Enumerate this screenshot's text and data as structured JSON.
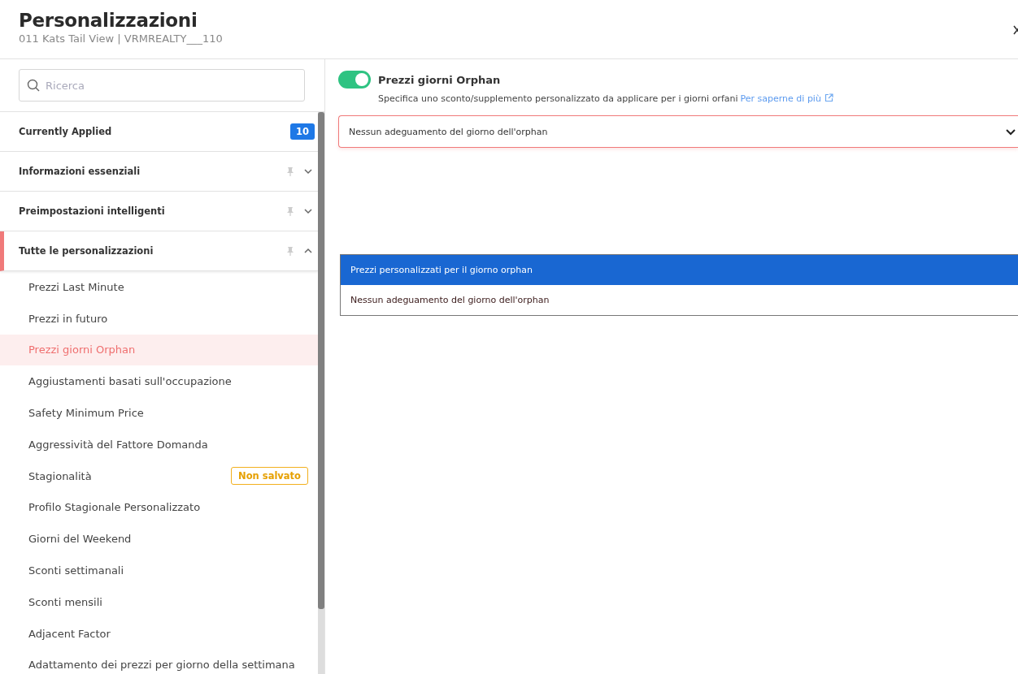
{
  "header": {
    "title": "Personalizzazioni",
    "subtitle": "011 Kats Tail View | VRMREALTY___110"
  },
  "search": {
    "placeholder": "Ricerca"
  },
  "sections": [
    {
      "label": "Currently Applied",
      "kind": "count",
      "count": "10"
    },
    {
      "label": "Informazioni essenziali",
      "kind": "group",
      "expanded": false,
      "selected": false
    },
    {
      "label": "Preimpostazioni intelligenti",
      "kind": "group",
      "expanded": false,
      "selected": false
    },
    {
      "label": "Tutte le personalizzazioni",
      "kind": "group",
      "expanded": true,
      "selected": true,
      "children": [
        {
          "label": "Prezzi Last Minute",
          "selected": false
        },
        {
          "label": "Prezzi in futuro",
          "selected": false
        },
        {
          "label": "Prezzi giorni Orphan",
          "selected": true
        },
        {
          "label": "Aggiustamenti basati sull'occupazione",
          "selected": false
        },
        {
          "label": "Safety Minimum Price",
          "selected": false
        },
        {
          "label": "Aggressività del Fattore Domanda",
          "selected": false
        },
        {
          "label": "Stagionalità",
          "selected": false,
          "badge": "Non salvato"
        },
        {
          "label": "Profilo Stagionale Personalizzato",
          "selected": false
        },
        {
          "label": "Giorni del Weekend",
          "selected": false
        },
        {
          "label": "Sconti settimanali",
          "selected": false
        },
        {
          "label": "Sconti mensili",
          "selected": false
        },
        {
          "label": "Adjacent Factor",
          "selected": false
        },
        {
          "label": "Adattamento dei prezzi per giorno della settimana",
          "selected": false
        }
      ]
    }
  ],
  "setting": {
    "title": "Prezzi giorni Orphan",
    "on": true,
    "description": "Specifica uno sconto/supplemento personalizzato da applicare per i giorni orfani",
    "link": "Per saperne di più"
  },
  "dropdown": {
    "value": "Nessun adeguamento del giorno dell'orphan",
    "invalid": true,
    "options": [
      {
        "label": "Prezzi personalizzati per il giorno orphan",
        "selected": false,
        "highlighted": true
      },
      {
        "label": "Nessun adeguamento del giorno dell'orphan",
        "selected": true,
        "highlighted": false
      }
    ]
  }
}
